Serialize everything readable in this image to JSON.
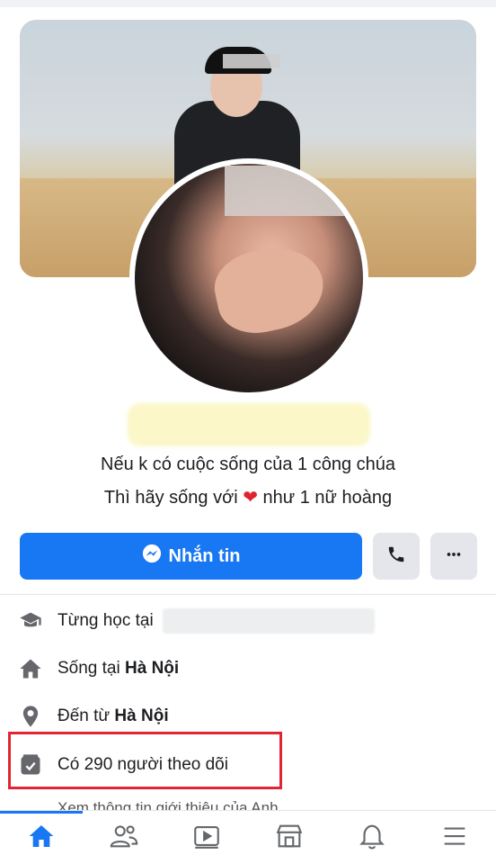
{
  "profile": {
    "bio_line1": "Nếu k có cuộc sống của 1 công chúa",
    "bio_line2_before": "Thì hãy sống với",
    "bio_line2_heart": "❤",
    "bio_line2_after": "như 1 nữ hoàng"
  },
  "actions": {
    "message_label": "Nhắn tin",
    "call_icon": "phone-icon",
    "more_icon": "more-dots-icon"
  },
  "info": {
    "studied_prefix": "Từng học tại",
    "lives_prefix": "Sống tại",
    "lives_place": "Hà Nội",
    "from_prefix": "Đến từ",
    "from_place": "Hà Nội",
    "followers_text": "Có 290 người theo dõi",
    "see_about_partial": "Xem thông tin giới thiệu của Anh"
  },
  "nav": {
    "items": [
      "home-icon",
      "friends-icon",
      "watch-icon",
      "marketplace-icon",
      "notifications-icon",
      "menu-icon"
    ],
    "active": "home-icon"
  },
  "colors": {
    "primary": "#1877f2",
    "highlight": "#e12535"
  }
}
